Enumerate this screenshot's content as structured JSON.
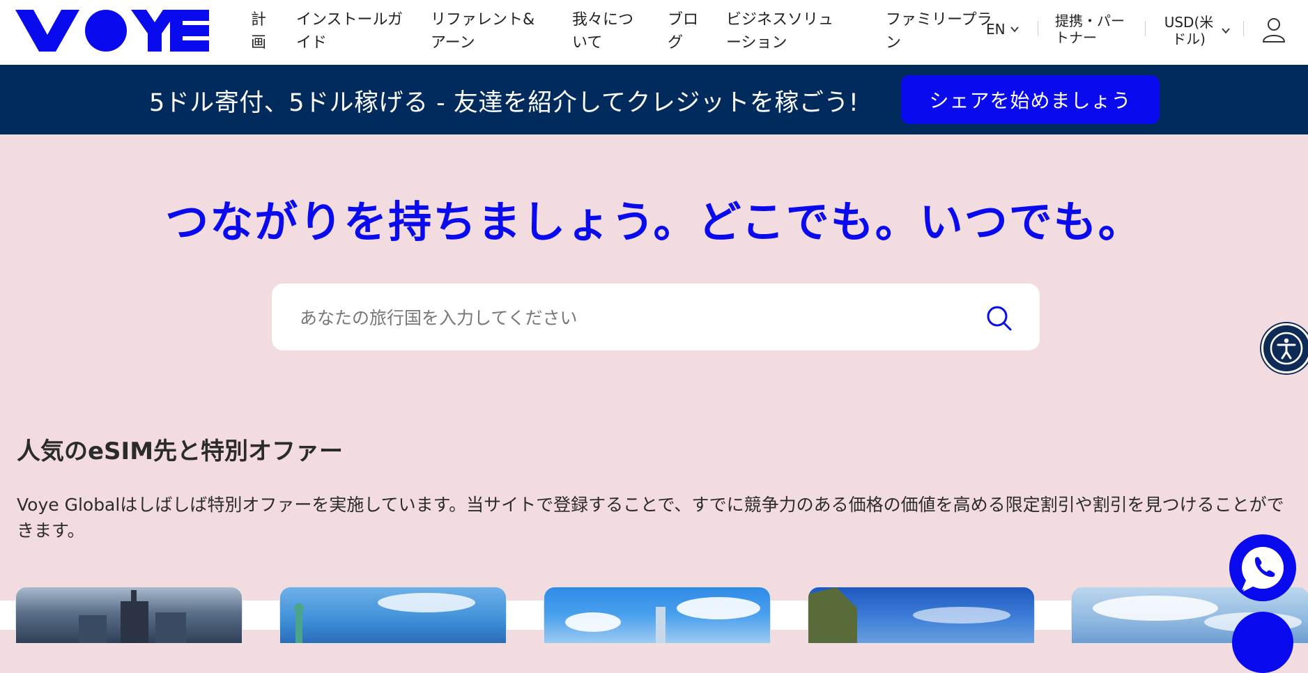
{
  "brand": {
    "logo_text": "VOYE",
    "accent": "#0a0aee",
    "banner_bg": "#002b5c",
    "page_bg": "#f3dcdf"
  },
  "nav": {
    "items": [
      {
        "label": "計画"
      },
      {
        "label": "インストールガイド"
      },
      {
        "label": "リファレント&アーン"
      },
      {
        "label": "我々について"
      },
      {
        "label": "ブログ"
      },
      {
        "label": "ビジネスソリューション"
      },
      {
        "label": "ファミリープラン"
      }
    ]
  },
  "utility": {
    "language": "EN",
    "partner": "提携・パートナー",
    "currency": "USD(米ドル)",
    "account_icon": "user-icon"
  },
  "banner": {
    "text": "5ドル寄付、5ドル稼げる - 友達を紹介してクレジットを稼ごう!",
    "button": "シェアを始めましょう"
  },
  "hero": {
    "title": "つながりを持ちましょう。どこでも。いつでも。",
    "search_placeholder": "あなたの旅行国を入力してください",
    "search_icon": "search-icon"
  },
  "section": {
    "title": "人気のeSIM先と特別オファー",
    "description": "Voye Globalはしばしば特別オファーを実施しています。当サイトで登録することで、すでに競争力のある価格の価値を高める限定割引や割引を見つけることができます。"
  },
  "floating": {
    "accessibility_icon": "accessibility-icon",
    "chat_icon": "phone-chat-icon"
  }
}
